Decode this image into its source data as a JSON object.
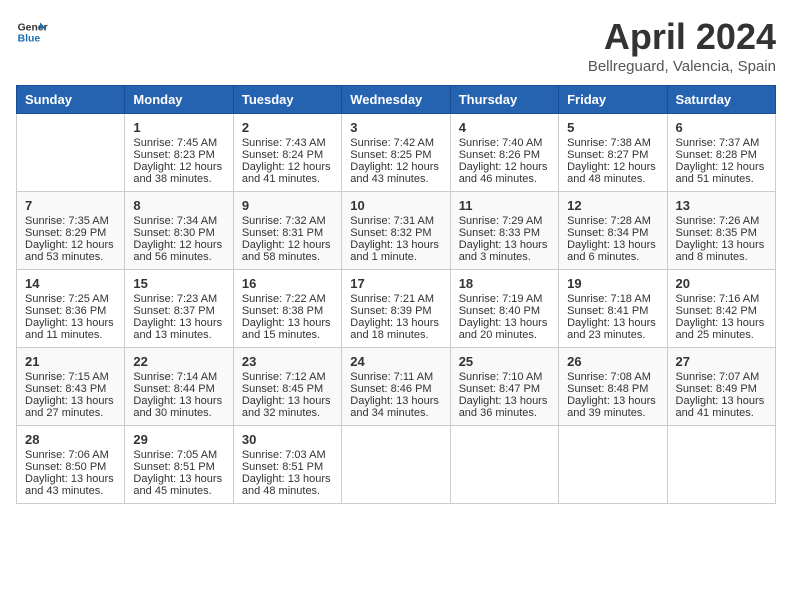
{
  "header": {
    "logo_line1": "General",
    "logo_line2": "Blue",
    "title": "April 2024",
    "subtitle": "Bellreguard, Valencia, Spain"
  },
  "weekdays": [
    "Sunday",
    "Monday",
    "Tuesday",
    "Wednesday",
    "Thursday",
    "Friday",
    "Saturday"
  ],
  "weeks": [
    [
      {
        "day": "",
        "sunrise": "",
        "sunset": "",
        "daylight": ""
      },
      {
        "day": "1",
        "sunrise": "Sunrise: 7:45 AM",
        "sunset": "Sunset: 8:23 PM",
        "daylight": "Daylight: 12 hours and 38 minutes."
      },
      {
        "day": "2",
        "sunrise": "Sunrise: 7:43 AM",
        "sunset": "Sunset: 8:24 PM",
        "daylight": "Daylight: 12 hours and 41 minutes."
      },
      {
        "day": "3",
        "sunrise": "Sunrise: 7:42 AM",
        "sunset": "Sunset: 8:25 PM",
        "daylight": "Daylight: 12 hours and 43 minutes."
      },
      {
        "day": "4",
        "sunrise": "Sunrise: 7:40 AM",
        "sunset": "Sunset: 8:26 PM",
        "daylight": "Daylight: 12 hours and 46 minutes."
      },
      {
        "day": "5",
        "sunrise": "Sunrise: 7:38 AM",
        "sunset": "Sunset: 8:27 PM",
        "daylight": "Daylight: 12 hours and 48 minutes."
      },
      {
        "day": "6",
        "sunrise": "Sunrise: 7:37 AM",
        "sunset": "Sunset: 8:28 PM",
        "daylight": "Daylight: 12 hours and 51 minutes."
      }
    ],
    [
      {
        "day": "7",
        "sunrise": "Sunrise: 7:35 AM",
        "sunset": "Sunset: 8:29 PM",
        "daylight": "Daylight: 12 hours and 53 minutes."
      },
      {
        "day": "8",
        "sunrise": "Sunrise: 7:34 AM",
        "sunset": "Sunset: 8:30 PM",
        "daylight": "Daylight: 12 hours and 56 minutes."
      },
      {
        "day": "9",
        "sunrise": "Sunrise: 7:32 AM",
        "sunset": "Sunset: 8:31 PM",
        "daylight": "Daylight: 12 hours and 58 minutes."
      },
      {
        "day": "10",
        "sunrise": "Sunrise: 7:31 AM",
        "sunset": "Sunset: 8:32 PM",
        "daylight": "Daylight: 13 hours and 1 minute."
      },
      {
        "day": "11",
        "sunrise": "Sunrise: 7:29 AM",
        "sunset": "Sunset: 8:33 PM",
        "daylight": "Daylight: 13 hours and 3 minutes."
      },
      {
        "day": "12",
        "sunrise": "Sunrise: 7:28 AM",
        "sunset": "Sunset: 8:34 PM",
        "daylight": "Daylight: 13 hours and 6 minutes."
      },
      {
        "day": "13",
        "sunrise": "Sunrise: 7:26 AM",
        "sunset": "Sunset: 8:35 PM",
        "daylight": "Daylight: 13 hours and 8 minutes."
      }
    ],
    [
      {
        "day": "14",
        "sunrise": "Sunrise: 7:25 AM",
        "sunset": "Sunset: 8:36 PM",
        "daylight": "Daylight: 13 hours and 11 minutes."
      },
      {
        "day": "15",
        "sunrise": "Sunrise: 7:23 AM",
        "sunset": "Sunset: 8:37 PM",
        "daylight": "Daylight: 13 hours and 13 minutes."
      },
      {
        "day": "16",
        "sunrise": "Sunrise: 7:22 AM",
        "sunset": "Sunset: 8:38 PM",
        "daylight": "Daylight: 13 hours and 15 minutes."
      },
      {
        "day": "17",
        "sunrise": "Sunrise: 7:21 AM",
        "sunset": "Sunset: 8:39 PM",
        "daylight": "Daylight: 13 hours and 18 minutes."
      },
      {
        "day": "18",
        "sunrise": "Sunrise: 7:19 AM",
        "sunset": "Sunset: 8:40 PM",
        "daylight": "Daylight: 13 hours and 20 minutes."
      },
      {
        "day": "19",
        "sunrise": "Sunrise: 7:18 AM",
        "sunset": "Sunset: 8:41 PM",
        "daylight": "Daylight: 13 hours and 23 minutes."
      },
      {
        "day": "20",
        "sunrise": "Sunrise: 7:16 AM",
        "sunset": "Sunset: 8:42 PM",
        "daylight": "Daylight: 13 hours and 25 minutes."
      }
    ],
    [
      {
        "day": "21",
        "sunrise": "Sunrise: 7:15 AM",
        "sunset": "Sunset: 8:43 PM",
        "daylight": "Daylight: 13 hours and 27 minutes."
      },
      {
        "day": "22",
        "sunrise": "Sunrise: 7:14 AM",
        "sunset": "Sunset: 8:44 PM",
        "daylight": "Daylight: 13 hours and 30 minutes."
      },
      {
        "day": "23",
        "sunrise": "Sunrise: 7:12 AM",
        "sunset": "Sunset: 8:45 PM",
        "daylight": "Daylight: 13 hours and 32 minutes."
      },
      {
        "day": "24",
        "sunrise": "Sunrise: 7:11 AM",
        "sunset": "Sunset: 8:46 PM",
        "daylight": "Daylight: 13 hours and 34 minutes."
      },
      {
        "day": "25",
        "sunrise": "Sunrise: 7:10 AM",
        "sunset": "Sunset: 8:47 PM",
        "daylight": "Daylight: 13 hours and 36 minutes."
      },
      {
        "day": "26",
        "sunrise": "Sunrise: 7:08 AM",
        "sunset": "Sunset: 8:48 PM",
        "daylight": "Daylight: 13 hours and 39 minutes."
      },
      {
        "day": "27",
        "sunrise": "Sunrise: 7:07 AM",
        "sunset": "Sunset: 8:49 PM",
        "daylight": "Daylight: 13 hours and 41 minutes."
      }
    ],
    [
      {
        "day": "28",
        "sunrise": "Sunrise: 7:06 AM",
        "sunset": "Sunset: 8:50 PM",
        "daylight": "Daylight: 13 hours and 43 minutes."
      },
      {
        "day": "29",
        "sunrise": "Sunrise: 7:05 AM",
        "sunset": "Sunset: 8:51 PM",
        "daylight": "Daylight: 13 hours and 45 minutes."
      },
      {
        "day": "30",
        "sunrise": "Sunrise: 7:03 AM",
        "sunset": "Sunset: 8:51 PM",
        "daylight": "Daylight: 13 hours and 48 minutes."
      },
      {
        "day": "",
        "sunrise": "",
        "sunset": "",
        "daylight": ""
      },
      {
        "day": "",
        "sunrise": "",
        "sunset": "",
        "daylight": ""
      },
      {
        "day": "",
        "sunrise": "",
        "sunset": "",
        "daylight": ""
      },
      {
        "day": "",
        "sunrise": "",
        "sunset": "",
        "daylight": ""
      }
    ]
  ]
}
